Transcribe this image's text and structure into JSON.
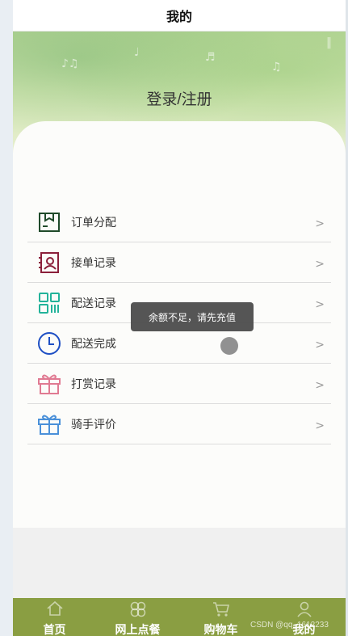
{
  "header": {
    "title": "我的"
  },
  "banner": {
    "login_label": "登录/注册"
  },
  "menu": {
    "items": [
      {
        "label": "订单分配",
        "icon": "box-icon",
        "color": "#1f4a2a"
      },
      {
        "label": "接单记录",
        "icon": "user-badge-icon",
        "color": "#8b1f3a"
      },
      {
        "label": "配送记录",
        "icon": "grid-icon",
        "color": "#23b39a"
      },
      {
        "label": "配送完成",
        "icon": "clock-icon",
        "color": "#1e4fc4"
      },
      {
        "label": "打赏记录",
        "icon": "gift-icon",
        "color": "#e07a92"
      },
      {
        "label": "骑手评价",
        "icon": "gift-icon",
        "color": "#4a90d9"
      }
    ],
    "chevron": ">"
  },
  "toast": {
    "message": "余额不足，请先充值"
  },
  "tabbar": {
    "background": "#8a9e42",
    "tabs": [
      {
        "label": "首页",
        "icon": "home-icon"
      },
      {
        "label": "网上点餐",
        "icon": "clover-icon"
      },
      {
        "label": "购物车",
        "icon": "cart-icon"
      },
      {
        "label": "我的",
        "icon": "user-icon"
      }
    ]
  },
  "watermark": "CSDN @qq_1612233"
}
